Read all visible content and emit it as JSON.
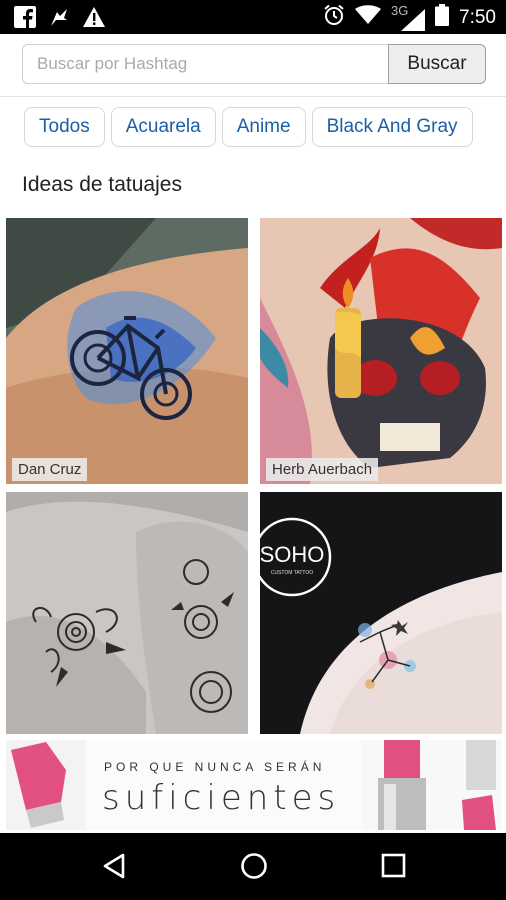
{
  "status_bar": {
    "network_label": "3G",
    "time": "7:50",
    "icons": [
      "facebook-icon",
      "notification-flag-icon",
      "warning-icon",
      "alarm-icon",
      "wifi-icon",
      "signal-icon",
      "battery-icon"
    ]
  },
  "search": {
    "placeholder": "Buscar por Hashtag",
    "button_label": "Buscar"
  },
  "chips": [
    {
      "label": "Todos"
    },
    {
      "label": "Acuarela"
    },
    {
      "label": "Anime"
    },
    {
      "label": "Black And Gray"
    }
  ],
  "section_title": "Ideas de tatuajes",
  "gallery": [
    {
      "artist": "Dan Cruz",
      "image": "watercolor-bicycle-tattoo"
    },
    {
      "artist": "Herb Auerbach",
      "image": "skull-candle-tattoo"
    },
    {
      "artist": "",
      "image": "floral-blackwork-tattoo"
    },
    {
      "artist": "",
      "image": "fine-line-constellation-tattoo",
      "logo_text": "SOHO",
      "logo_subtext": "CUSTOM TATTOO"
    }
  ],
  "ad": {
    "top_text": "POR QUE NUNCA SERÁN",
    "main_text": "suficientes"
  },
  "nav_bar": {
    "icons": [
      "back-icon",
      "home-icon",
      "recents-icon"
    ]
  },
  "colors": {
    "chip_text": "#1a5fa8",
    "status_bar": "#000000",
    "nav_bar": "#000000"
  }
}
